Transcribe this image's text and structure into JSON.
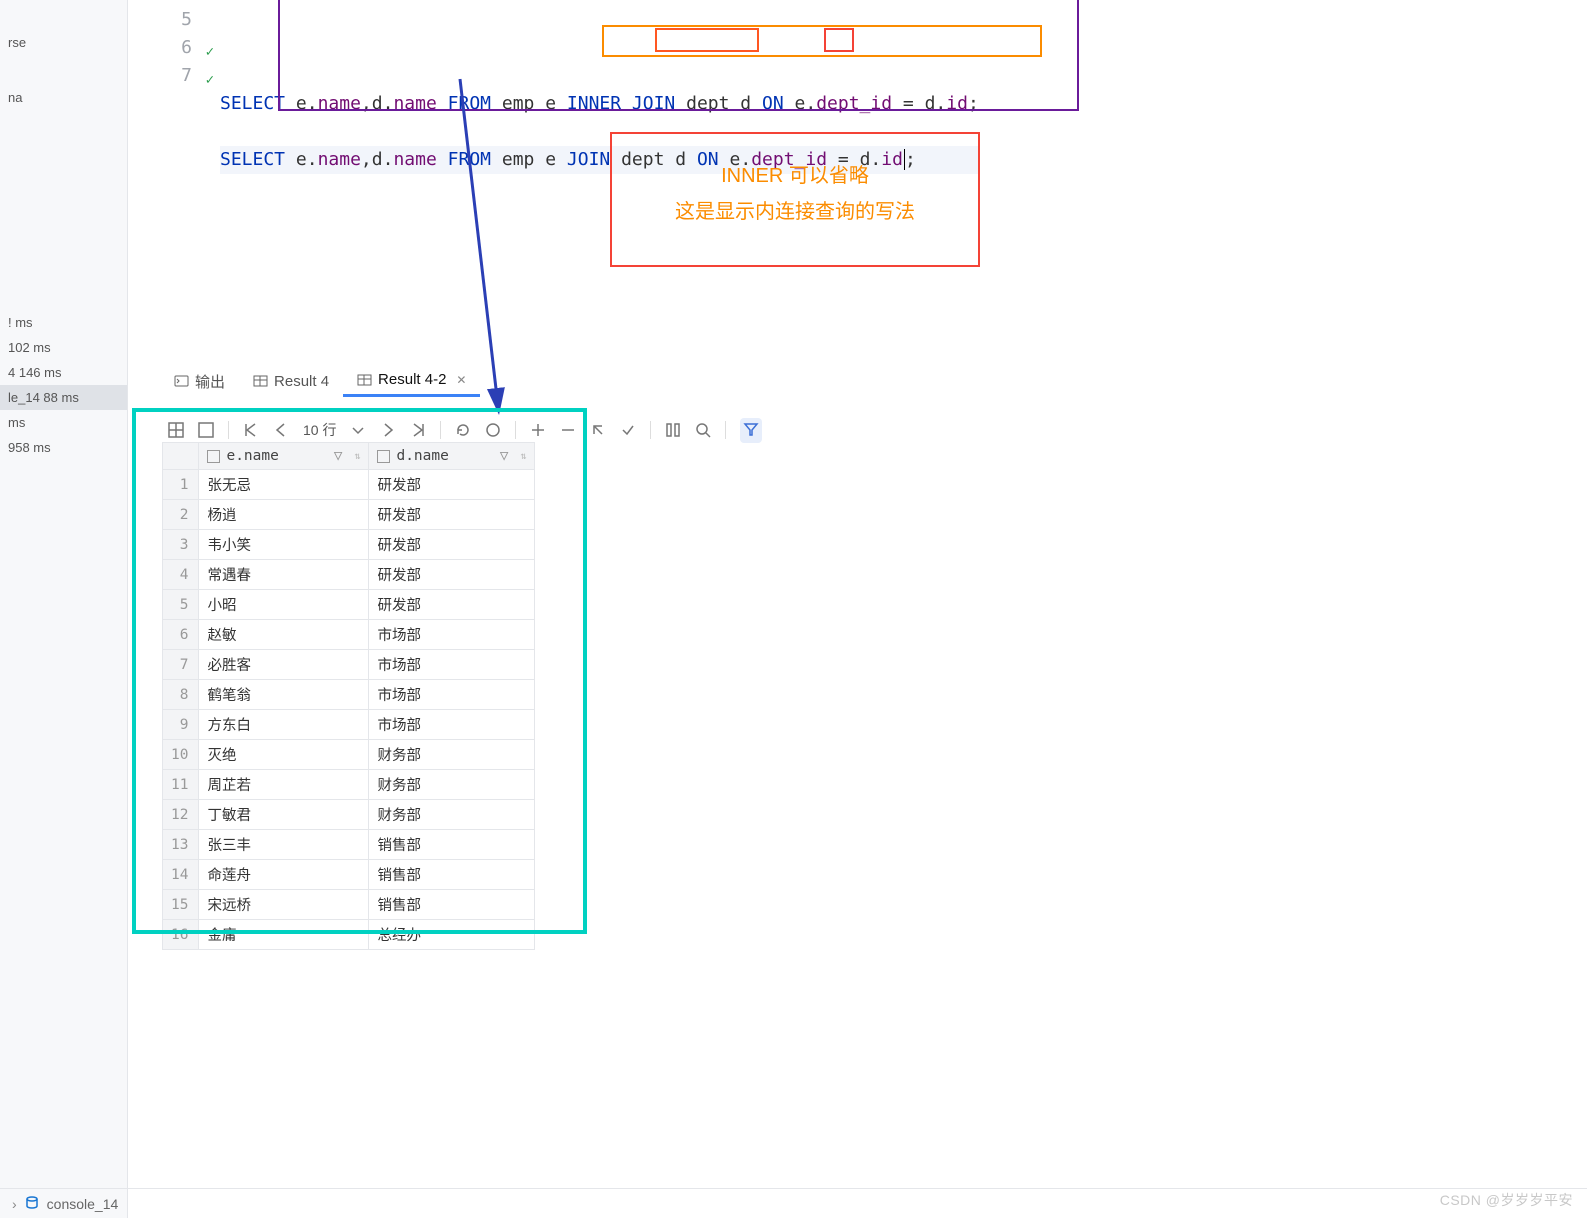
{
  "sidebar": {
    "items_top": [
      "rse",
      "na"
    ],
    "items_mid": [
      {
        "label": "! ms",
        "sel": false
      },
      {
        "label": "102 ms",
        "sel": false
      },
      {
        "label": "4  146 ms",
        "sel": false
      },
      {
        "label": "le_14  88 ms",
        "sel": true
      },
      {
        "label": "ms",
        "sel": false
      },
      {
        "label": "958 ms",
        "sel": false
      }
    ]
  },
  "editor": {
    "line5": {
      "num": "5"
    },
    "line6": {
      "num": "6",
      "select": "SELECT",
      "e": "e",
      "name1": "name",
      "d": "d",
      "name2": "name",
      "from": "FROM",
      "emp": "emp e",
      "inner": "INNER JOIN",
      "dept": "dept d",
      "on": "ON",
      "cond_left": "e",
      "cond_deptid": "dept_id",
      "eq": " = ",
      "cond_right": "d",
      "cond_id": "id",
      "semi": ";"
    },
    "line7": {
      "num": "7",
      "select": "SELECT",
      "e": "e",
      "name1": "name",
      "d": "d",
      "name2": "name",
      "from": "FROM",
      "emp": "emp e",
      "join": "JOIN",
      "dept": "dept d",
      "on": "ON",
      "cond_left": "e",
      "cond_deptid": "dept_id",
      "eq": " = ",
      "cond_right": "d",
      "cond_id": "id",
      "semi": ";"
    }
  },
  "note": {
    "line1": "INNER 可以省略",
    "line2": "这是显示内连接查询的写法"
  },
  "result": {
    "tabs": [
      {
        "label": "输出"
      },
      {
        "label": "Result 4"
      },
      {
        "label": "Result 4-2"
      }
    ],
    "page_label": "10 行",
    "columns": [
      "e.name",
      "d.name"
    ],
    "rows": [
      {
        "n": "1",
        "e": "张无忌",
        "d": "研发部"
      },
      {
        "n": "2",
        "e": "杨逍",
        "d": "研发部"
      },
      {
        "n": "3",
        "e": "韦小笑",
        "d": "研发部"
      },
      {
        "n": "4",
        "e": "常遇春",
        "d": "研发部"
      },
      {
        "n": "5",
        "e": "小昭",
        "d": "研发部"
      },
      {
        "n": "6",
        "e": "赵敏",
        "d": "市场部"
      },
      {
        "n": "7",
        "e": "必胜客",
        "d": "市场部"
      },
      {
        "n": "8",
        "e": "鹤笔翁",
        "d": "市场部"
      },
      {
        "n": "9",
        "e": "方东白",
        "d": "市场部"
      },
      {
        "n": "10",
        "e": "灭绝",
        "d": "财务部"
      },
      {
        "n": "11",
        "e": "周芷若",
        "d": "财务部"
      },
      {
        "n": "12",
        "e": "丁敏君",
        "d": "财务部"
      },
      {
        "n": "13",
        "e": "张三丰",
        "d": "销售部"
      },
      {
        "n": "14",
        "e": "命莲舟",
        "d": "销售部"
      },
      {
        "n": "15",
        "e": "宋远桥",
        "d": "销售部"
      },
      {
        "n": "16",
        "e": "金庸",
        "d": "总经办"
      }
    ]
  },
  "bottom": {
    "console": "console_14"
  },
  "watermark": "CSDN @岁岁岁平安"
}
